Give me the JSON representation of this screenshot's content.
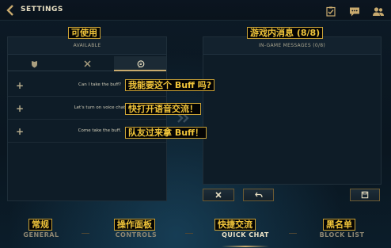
{
  "header": {
    "title": "SETTINGS",
    "icons": [
      "back-arrow-icon",
      "checklist-icon",
      "chat-bubble-icon",
      "friends-icon"
    ]
  },
  "left_panel": {
    "overlay_label": "可使用",
    "header": "AVAILABLE",
    "tabs": [
      {
        "icon": "shield-icon",
        "active": false
      },
      {
        "icon": "swords-icon",
        "active": false
      },
      {
        "icon": "chat-emote-icon",
        "active": true
      }
    ],
    "messages": [
      {
        "text": "Can I take the buff?",
        "translation": "我能要这个 Buff 吗?"
      },
      {
        "text": "Let's turn on voice chat",
        "translation": "快打开语音交流！"
      },
      {
        "text": "Come take the buff.",
        "translation": "队友过来拿 Buff！"
      }
    ]
  },
  "right_panel": {
    "overlay_label": "游戏内消息 (8/8)",
    "header": "IN-GAME MESSAGES (0/8)"
  },
  "actions": {
    "delete_icon": "x-icon",
    "undo_icon": "undo-arrow-icon",
    "save_icon": "save-disk-icon"
  },
  "bottom_nav": {
    "items": [
      {
        "label": "GENERAL",
        "translation": "常规",
        "active": false
      },
      {
        "label": "CONTROLS",
        "translation": "操作面板",
        "active": false
      },
      {
        "label": "QUICK CHAT",
        "translation": "快捷交流",
        "active": true
      },
      {
        "label": "BLOCK LIST",
        "translation": "黑名单",
        "active": false
      }
    ]
  },
  "colors": {
    "background": "#0a1722",
    "panel": "#0e1c27",
    "gold_accent": "#c8aa6e",
    "overlay_text": "#f0c43a"
  }
}
